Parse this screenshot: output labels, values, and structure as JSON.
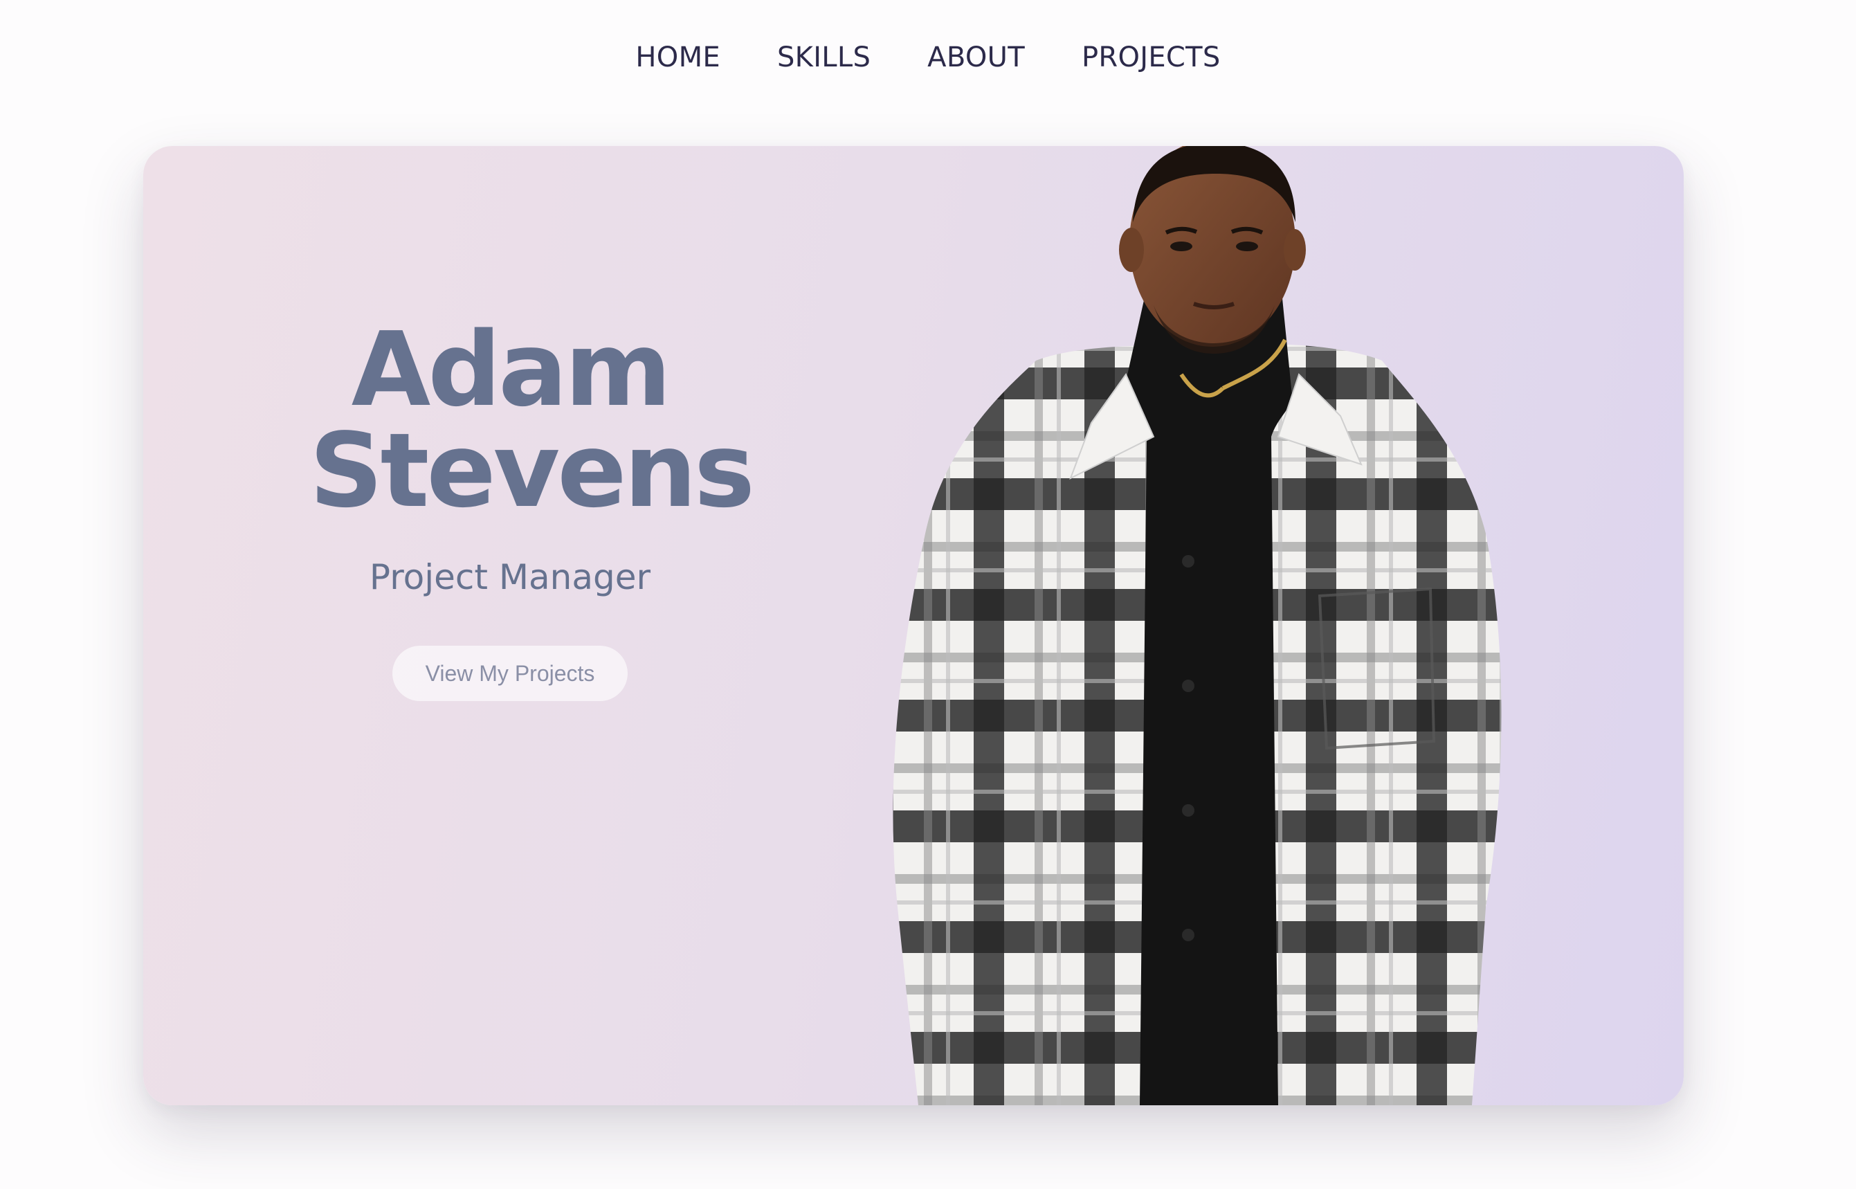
{
  "nav": {
    "items": [
      {
        "label": "HOME"
      },
      {
        "label": "SKILLS"
      },
      {
        "label": "ABOUT"
      },
      {
        "label": "PROJECTS"
      }
    ]
  },
  "hero": {
    "first_name": "Adam",
    "last_name": "Stevens",
    "role": "Project Manager",
    "cta_label": "View My Projects",
    "portrait_icon": "person-portrait-image"
  },
  "colors": {
    "accent": "#66728f",
    "nav_text": "#2c2a4a",
    "gradient_start": "#eee0e8",
    "gradient_end": "#ddd5ee"
  }
}
